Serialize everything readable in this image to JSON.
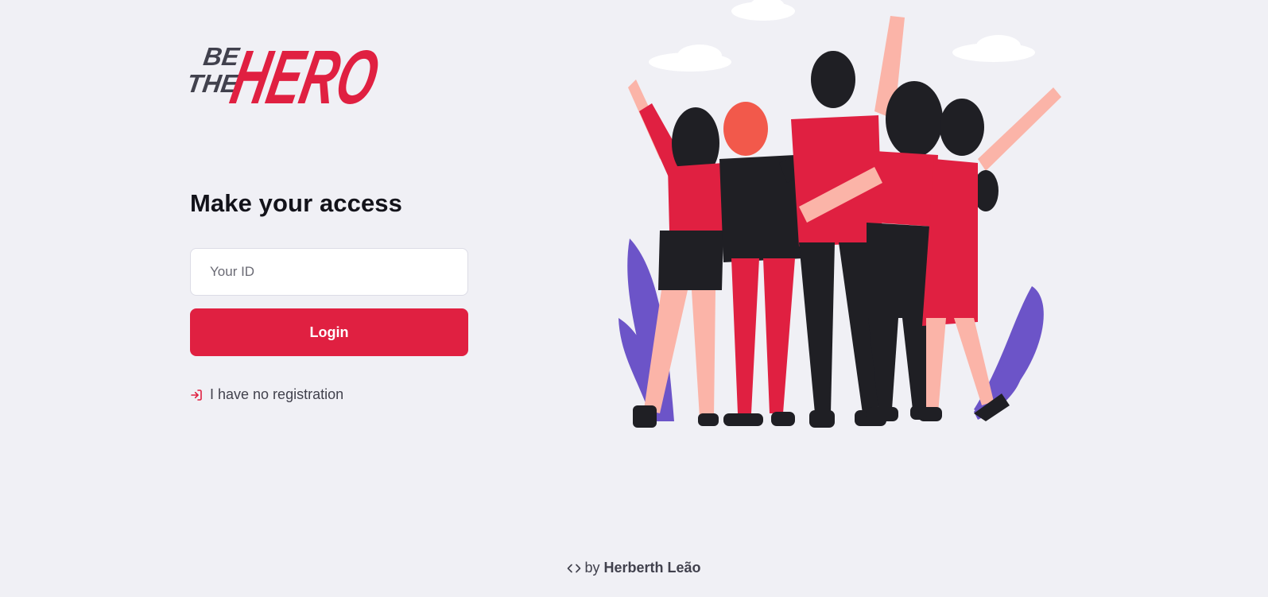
{
  "brand": {
    "logo_text": "BE THE HERO",
    "logo_small_top": "BE",
    "logo_small_bottom": "THE",
    "logo_big": "HERO",
    "primary_color": "#e02041",
    "dark_color": "#41414d",
    "background_color": "#f0f0f5"
  },
  "login": {
    "title": "Make your access",
    "id_placeholder": "Your ID",
    "id_value": "",
    "button_label": "Login",
    "register_link_label": "I have no registration",
    "register_icon": "log-in-icon"
  },
  "footer": {
    "code_icon": "code-icon",
    "by_text": "by",
    "author": "Herberth Leão"
  },
  "illustration": {
    "icon": "group-of-friends-illustration"
  }
}
